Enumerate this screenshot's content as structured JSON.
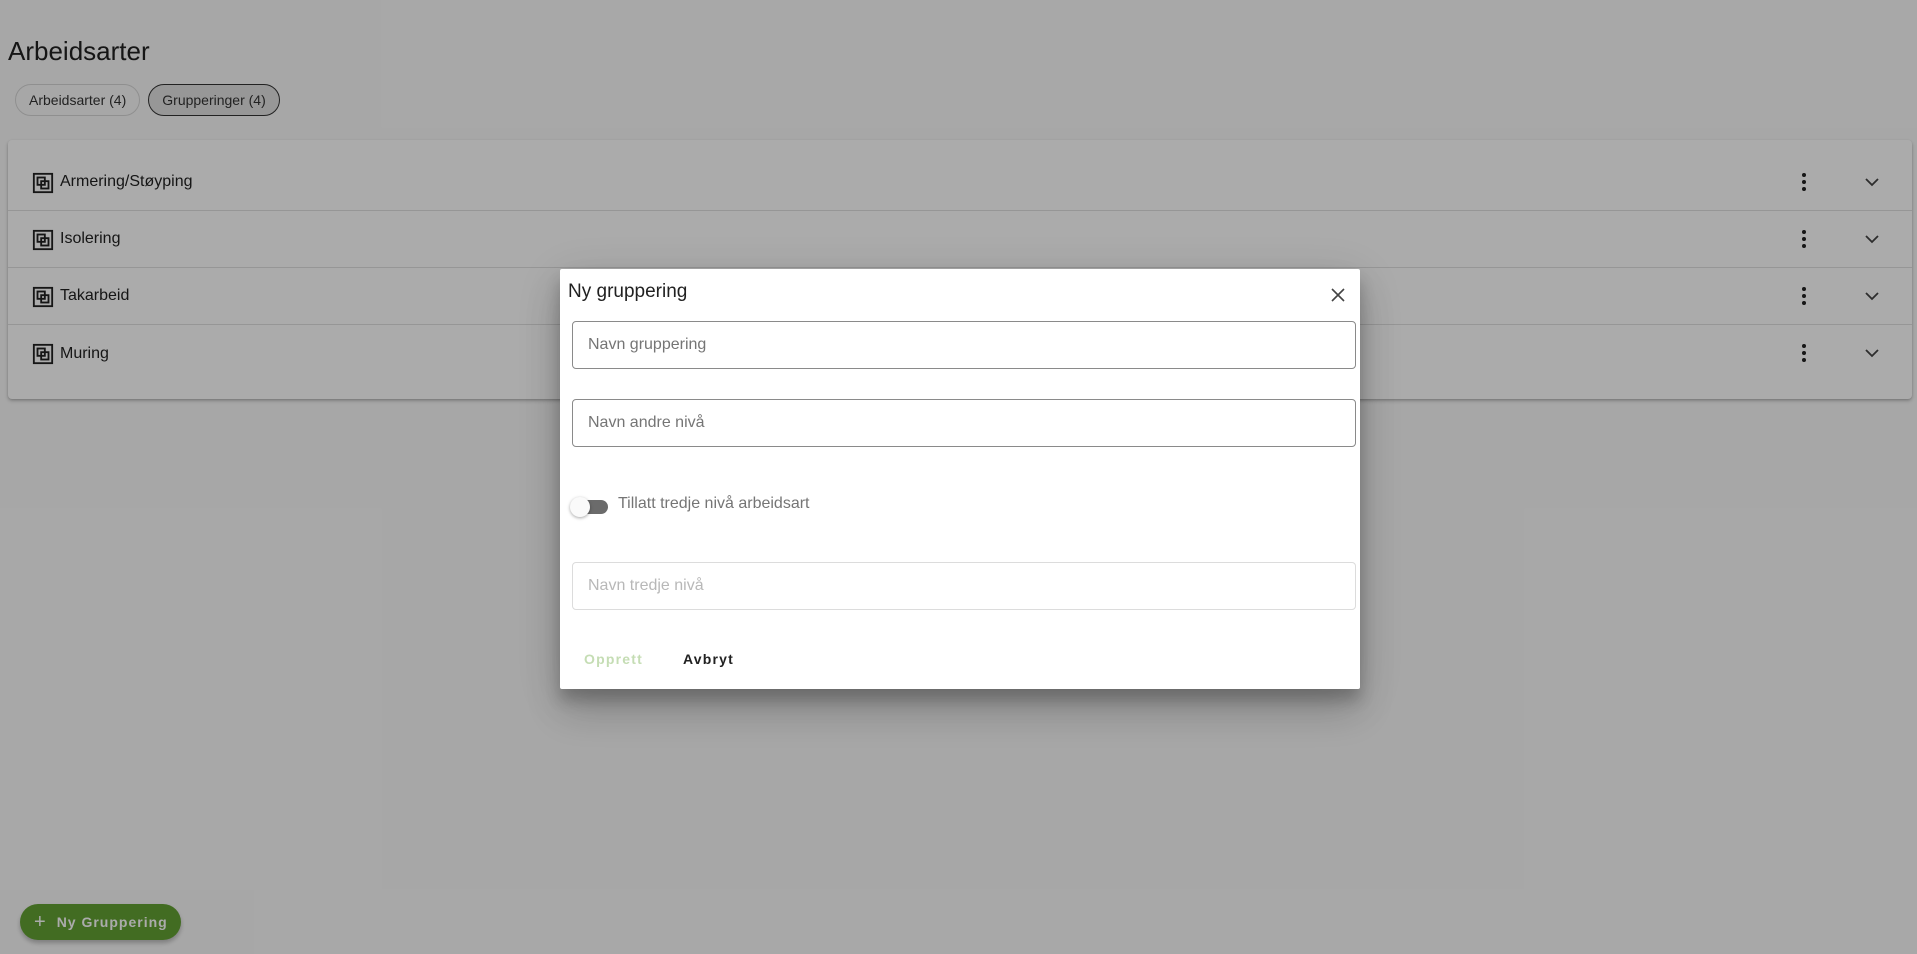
{
  "page": {
    "title": "Arbeidsarter"
  },
  "tabs": [
    {
      "label": "Arbeidsarter (4)",
      "active": false
    },
    {
      "label": "Grupperinger (4)",
      "active": true
    }
  ],
  "groups": [
    {
      "label": "Armering/Støyping"
    },
    {
      "label": "Isolering"
    },
    {
      "label": "Takarbeid"
    },
    {
      "label": "Muring"
    }
  ],
  "icons": {
    "group": "group-icon",
    "more": "more-vert-icon",
    "expand": "chevron-down-icon",
    "close": "close-icon",
    "add": "plus-icon"
  },
  "fab": {
    "plus": "+",
    "label": "Ny Gruppering"
  },
  "dialog": {
    "title": "Ny gruppering",
    "name_placeholder": "Navn gruppering",
    "second_level_placeholder": "Navn andre nivå",
    "toggle_label": "Tillatt tredje nivå arbeidsart",
    "toggle_on": false,
    "third_level_placeholder": "Navn tredje nivå",
    "create_label": "Opprett",
    "cancel_label": "Avbryt"
  },
  "colors": {
    "accent": "#63a133",
    "accent_disabled": "#c5ddb4",
    "overlay": "rgba(0,0,0,0.33)"
  }
}
